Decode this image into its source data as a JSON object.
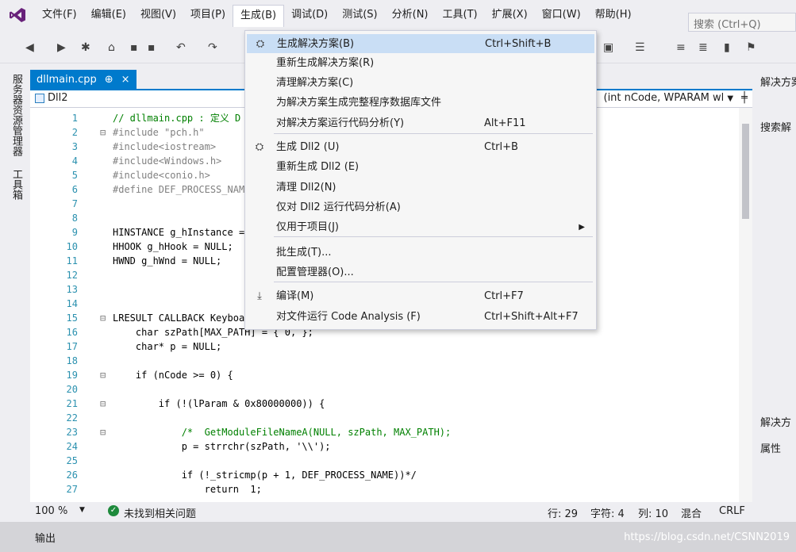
{
  "menubar": {
    "items": [
      "文件(F)",
      "编辑(E)",
      "视图(V)",
      "项目(P)",
      "生成(B)",
      "调试(D)",
      "测试(S)",
      "分析(N)",
      "工具(T)",
      "扩展(X)",
      "窗口(W)",
      "帮助(H)"
    ],
    "search_placeholder": "搜索 (Ctrl+Q)"
  },
  "left_strip": {
    "tab1": "服务器资源管理器",
    "tab2": "工具箱"
  },
  "doc": {
    "tab_label": "dllmain.cpp",
    "tab_pin": "⊕",
    "tab_close": "×",
    "nav_project": "Dll2",
    "nav_function": "(int nCode, WPARAM wl"
  },
  "code_lines": [
    {
      "n": "1",
      "t": "// dllmain.cpp : 定义 D"
    },
    {
      "n": "2",
      "t": "#include \"pch.h\""
    },
    {
      "n": "3",
      "t": "#include<iostream>"
    },
    {
      "n": "4",
      "t": "#include<Windows.h>"
    },
    {
      "n": "5",
      "t": "#include<conio.h>"
    },
    {
      "n": "6",
      "t": "#define DEF_PROCESS_NAM"
    },
    {
      "n": "7",
      "t": ""
    },
    {
      "n": "8",
      "t": ""
    },
    {
      "n": "9",
      "t": "HINSTANCE g_hInstance ="
    },
    {
      "n": "10",
      "t": "HHOOK g_hHook = NULL;"
    },
    {
      "n": "11",
      "t": "HWND g_hWnd = NULL;"
    },
    {
      "n": "12",
      "t": ""
    },
    {
      "n": "13",
      "t": ""
    },
    {
      "n": "14",
      "t": ""
    },
    {
      "n": "15",
      "t": "LRESULT CALLBACK Keyboa"
    },
    {
      "n": "16",
      "t": "    char szPath[MAX_PATH] = { 0, };"
    },
    {
      "n": "17",
      "t": "    char* p = NULL;"
    },
    {
      "n": "18",
      "t": ""
    },
    {
      "n": "19",
      "t": "    if (nCode >= 0) {"
    },
    {
      "n": "20",
      "t": ""
    },
    {
      "n": "21",
      "t": "        if (!(lParam & 0x80000000)) {"
    },
    {
      "n": "22",
      "t": ""
    },
    {
      "n": "23",
      "t": "            /*  GetModuleFileNameA(NULL, szPath, MAX_PATH);"
    },
    {
      "n": "24",
      "t": "            p = strrchr(szPath, '\\\\');"
    },
    {
      "n": "25",
      "t": ""
    },
    {
      "n": "26",
      "t": "            if (!_stricmp(p + 1, DEF_PROCESS_NAME))*/"
    },
    {
      "n": "27",
      "t": "                return  1;"
    }
  ],
  "status": {
    "zoom": "100 %",
    "issues": "未找到相关问题",
    "line": "行: 29",
    "char": "字符: 4",
    "col": "列: 10",
    "mode": "混合",
    "eol": "CRLF"
  },
  "right_panel": {
    "title": "解决方案",
    "search": "搜索解",
    "solution_label": "解决方",
    "properties": "属性"
  },
  "output": {
    "label": "输出",
    "watermark": "https://blog.csdn.net/CSNN2019"
  },
  "build_menu": {
    "items": [
      {
        "label": "生成解决方案(B)",
        "shortcut": "Ctrl+Shift+B",
        "icon": "build-solution-icon"
      },
      {
        "label": "重新生成解决方案(R)",
        "shortcut": ""
      },
      {
        "label": "清理解决方案(C)",
        "shortcut": ""
      },
      {
        "label": "为解决方案生成完整程序数据库文件",
        "shortcut": ""
      },
      {
        "label": "对解决方案运行代码分析(Y)",
        "shortcut": "Alt+F11"
      },
      {
        "label": "生成 Dll2 (U)",
        "shortcut": "Ctrl+B",
        "icon": "build-project-icon"
      },
      {
        "label": "重新生成 Dll2 (E)",
        "shortcut": ""
      },
      {
        "label": "清理 Dll2(N)",
        "shortcut": ""
      },
      {
        "label": "仅对 Dll2 运行代码分析(A)",
        "shortcut": ""
      },
      {
        "label": "仅用于项目(J)",
        "shortcut": "",
        "submenu": true
      },
      {
        "label": "批生成(T)...",
        "shortcut": ""
      },
      {
        "label": "配置管理器(O)...",
        "shortcut": ""
      },
      {
        "label": "编译(M)",
        "shortcut": "Ctrl+F7",
        "icon": "compile-icon"
      },
      {
        "label": "对文件运行 Code Analysis (F)",
        "shortcut": "Ctrl+Shift+Alt+F7"
      }
    ]
  }
}
